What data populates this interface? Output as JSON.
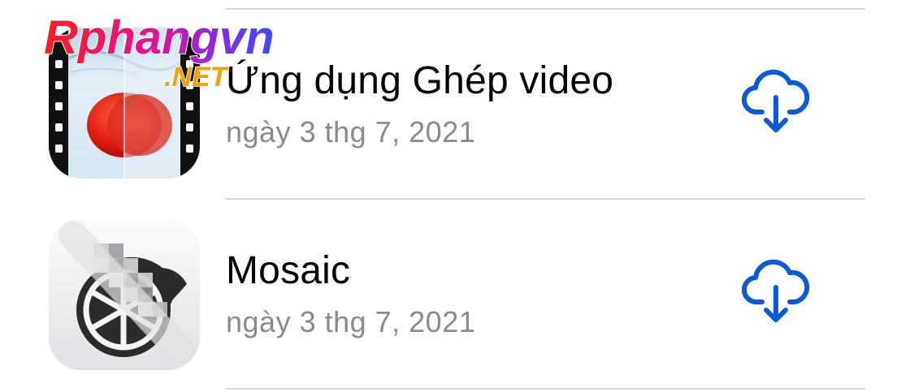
{
  "watermark": {
    "brand": "Rphangvn",
    "suffix": ".NET"
  },
  "apps": [
    {
      "name": "Ứng dụng Ghép video",
      "date": "ngày 3 thg 7, 2021",
      "icon": "video-merge-tomato-icon",
      "action_icon": "cloud-download-icon"
    },
    {
      "name": "Mosaic",
      "date": "ngày 3 thg 7, 2021",
      "icon": "mosaic-blur-icon",
      "action_icon": "cloud-download-icon"
    }
  ],
  "colors": {
    "accent": "#0a5bd3",
    "secondary_text": "#8a8a8e",
    "separator": "#d8d8dc"
  }
}
